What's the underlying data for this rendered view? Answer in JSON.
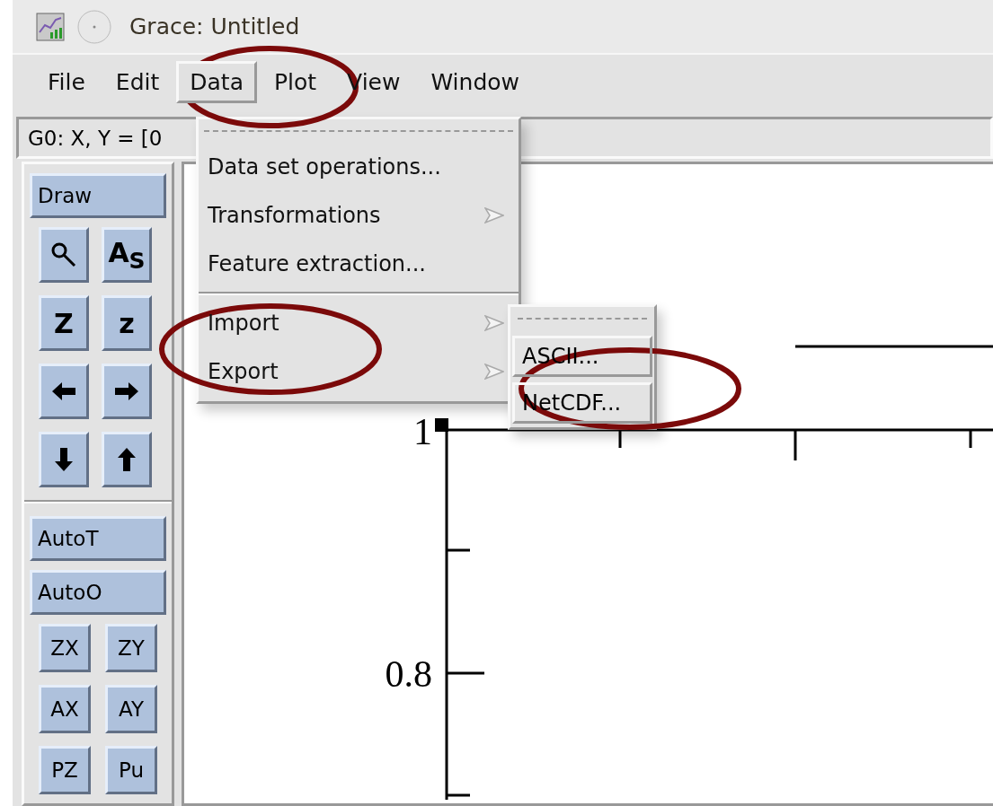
{
  "window": {
    "title": "Grace: Untitled"
  },
  "menu_bar": [
    {
      "label": "File",
      "selected": false
    },
    {
      "label": "Edit",
      "selected": false
    },
    {
      "label": "Data",
      "selected": true
    },
    {
      "label": "Plot",
      "selected": false
    },
    {
      "label": "View",
      "selected": false
    },
    {
      "label": "Window",
      "selected": false
    }
  ],
  "status": "G0: X, Y = [0",
  "toolbar": {
    "draw_button": "Draw",
    "icon_buttons": [
      {
        "kind": "zoom"
      },
      {
        "kind": "text",
        "label": "A$_{S}$"
      },
      {
        "kind": "text",
        "label": "Z"
      },
      {
        "kind": "text",
        "label": "z"
      },
      {
        "kind": "left"
      },
      {
        "kind": "right"
      },
      {
        "kind": "down"
      },
      {
        "kind": "up"
      }
    ],
    "auto_buttons": [
      "AutoT",
      "AutoO"
    ],
    "small_buttons": [
      "ZX",
      "ZY",
      "AX",
      "AY",
      "PZ",
      "Pu"
    ]
  },
  "data_menu": {
    "items": [
      {
        "kind": "action",
        "label": "Data set operations..."
      },
      {
        "kind": "submenu",
        "label": "Transformations"
      },
      {
        "kind": "action",
        "label": "Feature extraction..."
      },
      {
        "kind": "separator"
      },
      {
        "kind": "submenu",
        "label": "Import"
      },
      {
        "kind": "submenu",
        "label": "Export"
      }
    ]
  },
  "import_submenu": {
    "items": [
      "ASCII...",
      "NetCDF..."
    ]
  },
  "plot": {
    "y_tick_labels": [
      "1",
      "0.8"
    ]
  }
}
